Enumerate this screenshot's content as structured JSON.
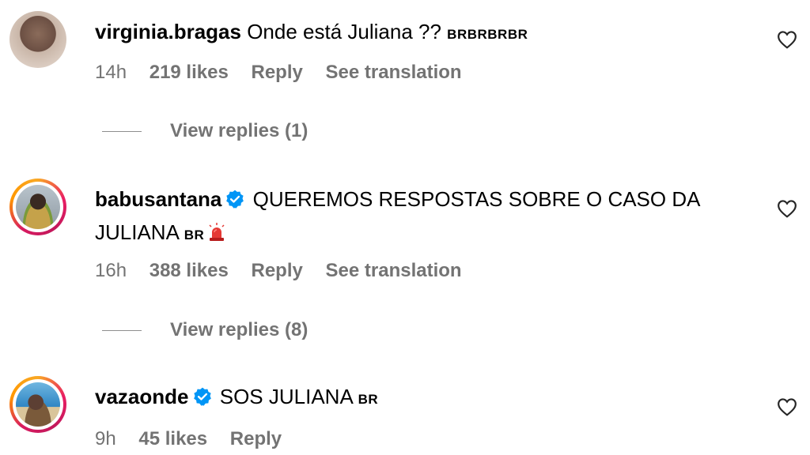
{
  "comments": [
    {
      "username": "virginia.bragas",
      "verified": false,
      "text": "Onde está Juliana ??",
      "flags": "BRBRBRBR",
      "time": "14h",
      "likes": "219 likes",
      "reply": "Reply",
      "translate": "See translation",
      "view_replies": "View replies (1)"
    },
    {
      "username": "babusantana",
      "verified": true,
      "text": "QUEREMOS RESPOSTAS SOBRE O CASO DA",
      "text_line2": "JULIANA",
      "flags": "BR",
      "emoji": "siren-icon",
      "time": "16h",
      "likes": "388 likes",
      "reply": "Reply",
      "translate": "See translation",
      "view_replies": "View replies (8)"
    },
    {
      "username": "vazaonde",
      "verified": true,
      "text": "SOS JULIANA",
      "flags": "BR",
      "time": "9h",
      "likes": "45 likes",
      "reply": "Reply"
    }
  ],
  "colors": {
    "text": "#000000",
    "secondary": "#737373",
    "verified": "#0095f6"
  }
}
